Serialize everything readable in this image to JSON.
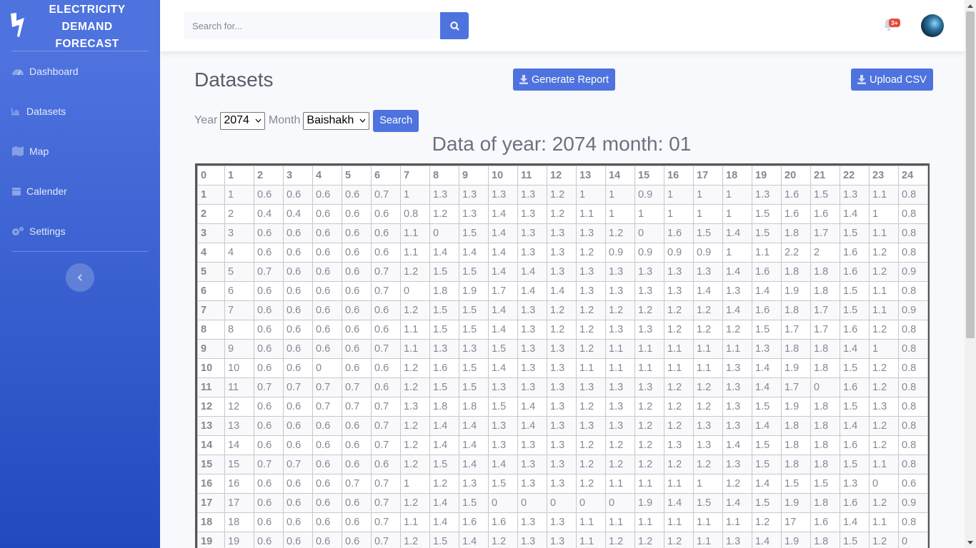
{
  "brand": {
    "title_line1": "ELECTRICITY",
    "title_line2": "DEMAND",
    "title_line3": "FORECAST"
  },
  "sidebar": {
    "items": [
      {
        "label": "Dashboard",
        "icon": "tachometer-icon"
      },
      {
        "label": "Datasets",
        "icon": "chart-area-icon"
      },
      {
        "label": "Map",
        "icon": "map-icon"
      },
      {
        "label": "Calender",
        "icon": "calendar-icon"
      },
      {
        "label": "Settings",
        "icon": "cogs-icon"
      }
    ]
  },
  "topbar": {
    "search_placeholder": "Search for...",
    "alerts_badge": "3+"
  },
  "page": {
    "title": "Datasets",
    "generate_report_label": "Generate Report",
    "upload_csv_label": "Upload CSV"
  },
  "filter": {
    "year_label": "Year",
    "year_value": "2074",
    "month_label": "Month",
    "month_value": "Baishakh",
    "search_label": "Search"
  },
  "heading": "Data of year: 2074 month: 01",
  "table": {
    "header": [
      "0",
      "1",
      "2",
      "3",
      "4",
      "5",
      "6",
      "7",
      "8",
      "9",
      "10",
      "11",
      "12",
      "13",
      "14",
      "15",
      "16",
      "17",
      "18",
      "19",
      "20",
      "21",
      "22",
      "23",
      "24"
    ],
    "rows": [
      [
        "1",
        "1",
        "0.6",
        "0.6",
        "0.6",
        "0.6",
        "0.7",
        "1",
        "1.3",
        "1.3",
        "1.3",
        "1.3",
        "1.2",
        "1",
        "1",
        "0.9",
        "1",
        "1",
        "1",
        "1.3",
        "1.6",
        "1.5",
        "1.3",
        "1.1",
        "0.8"
      ],
      [
        "2",
        "2",
        "0.4",
        "0.4",
        "0.6",
        "0.6",
        "0.6",
        "0.8",
        "1.2",
        "1.3",
        "1.4",
        "1.3",
        "1.2",
        "1.1",
        "1",
        "1",
        "1",
        "1",
        "1",
        "1.5",
        "1.6",
        "1.6",
        "1.4",
        "1",
        "0.8"
      ],
      [
        "3",
        "3",
        "0.6",
        "0.6",
        "0.6",
        "0.6",
        "0.6",
        "1.1",
        "0",
        "1.5",
        "1.4",
        "1.3",
        "1.3",
        "1.3",
        "1.2",
        "0",
        "1.6",
        "1.5",
        "1.4",
        "1.5",
        "1.8",
        "1.7",
        "1.5",
        "1.1",
        "0.8"
      ],
      [
        "4",
        "4",
        "0.6",
        "0.6",
        "0.6",
        "0.6",
        "0.6",
        "1.1",
        "1.4",
        "1.4",
        "1.4",
        "1.3",
        "1.3",
        "1.2",
        "0.9",
        "0.9",
        "0.9",
        "0.9",
        "1",
        "1.1",
        "2.2",
        "2",
        "1.6",
        "1.2",
        "0.8"
      ],
      [
        "5",
        "5",
        "0.7",
        "0.6",
        "0.6",
        "0.6",
        "0.7",
        "1.2",
        "1.5",
        "1.5",
        "1.4",
        "1.4",
        "1.3",
        "1.3",
        "1.3",
        "1.3",
        "1.3",
        "1.3",
        "1.4",
        "1.6",
        "1.8",
        "1.8",
        "1.6",
        "1.2",
        "0.9"
      ],
      [
        "6",
        "6",
        "0.6",
        "0.6",
        "0.6",
        "0.6",
        "0.7",
        "0",
        "1.8",
        "1.9",
        "1.7",
        "1.4",
        "1.4",
        "1.3",
        "1.3",
        "1.3",
        "1.3",
        "1.4",
        "1.3",
        "1.4",
        "1.9",
        "1.8",
        "1.5",
        "1.1",
        "0.8"
      ],
      [
        "7",
        "7",
        "0.6",
        "0.6",
        "0.6",
        "0.6",
        "0.6",
        "1.2",
        "1.5",
        "1.5",
        "1.4",
        "1.3",
        "1.2",
        "1.2",
        "1.2",
        "1.2",
        "1.2",
        "1.2",
        "1.4",
        "1.6",
        "1.8",
        "1.7",
        "1.5",
        "1.1",
        "0.9"
      ],
      [
        "8",
        "8",
        "0.6",
        "0.6",
        "0.6",
        "0.6",
        "0.6",
        "1.1",
        "1.5",
        "1.5",
        "1.4",
        "1.3",
        "1.2",
        "1.2",
        "1.3",
        "1.3",
        "1.2",
        "1.2",
        "1.2",
        "1.5",
        "1.7",
        "1.7",
        "1.6",
        "1.2",
        "0.8"
      ],
      [
        "9",
        "9",
        "0.6",
        "0.6",
        "0.6",
        "0.6",
        "0.7",
        "1.1",
        "1.3",
        "1.3",
        "1.5",
        "1.3",
        "1.3",
        "1.2",
        "1.1",
        "1.1",
        "1.1",
        "1.1",
        "1.1",
        "1.3",
        "1.8",
        "1.8",
        "1.4",
        "1",
        "0.8"
      ],
      [
        "10",
        "10",
        "0.6",
        "0.6",
        "0",
        "0.6",
        "0.6",
        "1.2",
        "1.6",
        "1.5",
        "1.4",
        "1.3",
        "1.3",
        "1.1",
        "1.1",
        "1.1",
        "1.1",
        "1.1",
        "1.3",
        "1.4",
        "1.9",
        "1.8",
        "1.5",
        "1.2",
        "0.8"
      ],
      [
        "11",
        "11",
        "0.7",
        "0.7",
        "0.7",
        "0.7",
        "0.6",
        "1.2",
        "1.5",
        "1.5",
        "1.3",
        "1.3",
        "1.3",
        "1.3",
        "1.3",
        "1.3",
        "1.2",
        "1.2",
        "1.3",
        "1.4",
        "1.7",
        "0",
        "1.6",
        "1.2",
        "0.8"
      ],
      [
        "12",
        "12",
        "0.6",
        "0.6",
        "0.7",
        "0.7",
        "0.7",
        "1.3",
        "1.8",
        "1.8",
        "1.5",
        "1.4",
        "1.3",
        "1.2",
        "1.3",
        "1.2",
        "1.2",
        "1.2",
        "1.3",
        "1.5",
        "1.9",
        "1.8",
        "1.5",
        "1.3",
        "0.8"
      ],
      [
        "13",
        "13",
        "0.6",
        "0.6",
        "0.6",
        "0.6",
        "0.7",
        "1.2",
        "1.4",
        "1.4",
        "1.3",
        "1.4",
        "1.3",
        "1.3",
        "1.3",
        "1.2",
        "1.2",
        "1.3",
        "1.3",
        "1.4",
        "1.8",
        "1.8",
        "1.4",
        "1.2",
        "0.8"
      ],
      [
        "14",
        "14",
        "0.6",
        "0.6",
        "0.6",
        "0.6",
        "0.7",
        "1.2",
        "1.4",
        "1.4",
        "1.3",
        "1.3",
        "1.3",
        "1.2",
        "1.2",
        "1.2",
        "1.3",
        "1.3",
        "1.4",
        "1.5",
        "1.8",
        "1.8",
        "1.6",
        "1.2",
        "0.8"
      ],
      [
        "15",
        "15",
        "0.7",
        "0.7",
        "0.6",
        "0.6",
        "0.6",
        "1.2",
        "1.5",
        "1.4",
        "1.4",
        "1.3",
        "1.3",
        "1.2",
        "1.2",
        "1.2",
        "1.2",
        "1.2",
        "1.3",
        "1.5",
        "1.8",
        "1.8",
        "1.5",
        "1.1",
        "0.8"
      ],
      [
        "16",
        "16",
        "0.6",
        "0.6",
        "0.6",
        "0.7",
        "0.7",
        "1",
        "1.2",
        "1.3",
        "1.5",
        "1.3",
        "1.3",
        "1.2",
        "1.1",
        "1.1",
        "1.1",
        "1",
        "1.2",
        "1.4",
        "1.5",
        "1.5",
        "1.3",
        "0",
        "0.6"
      ],
      [
        "17",
        "17",
        "0.6",
        "0.6",
        "0.6",
        "0.6",
        "0.7",
        "1.2",
        "1.4",
        "1.5",
        "0",
        "0",
        "0",
        "0",
        "0",
        "1.9",
        "1.4",
        "1.5",
        "1.4",
        "1.5",
        "1.9",
        "1.8",
        "1.6",
        "1.2",
        "0.9"
      ],
      [
        "18",
        "18",
        "0.6",
        "0.6",
        "0.6",
        "0.6",
        "0.7",
        "1.1",
        "1.4",
        "1.6",
        "1.6",
        "1.3",
        "1.3",
        "1.1",
        "1.1",
        "1.1",
        "1.1",
        "1.1",
        "1.1",
        "1.2",
        "17",
        "1.6",
        "1.4",
        "1.1",
        "0.8"
      ],
      [
        "19",
        "19",
        "0.6",
        "0.6",
        "0.6",
        "0.6",
        "0.7",
        "1.2",
        "1.5",
        "1.4",
        "1.2",
        "1.3",
        "1.3",
        "1.1",
        "1.2",
        "1.2",
        "1.2",
        "1.1",
        "1.3",
        "1.4",
        "1.9",
        "1.8",
        "1.5",
        "1.2",
        "0"
      ]
    ]
  }
}
